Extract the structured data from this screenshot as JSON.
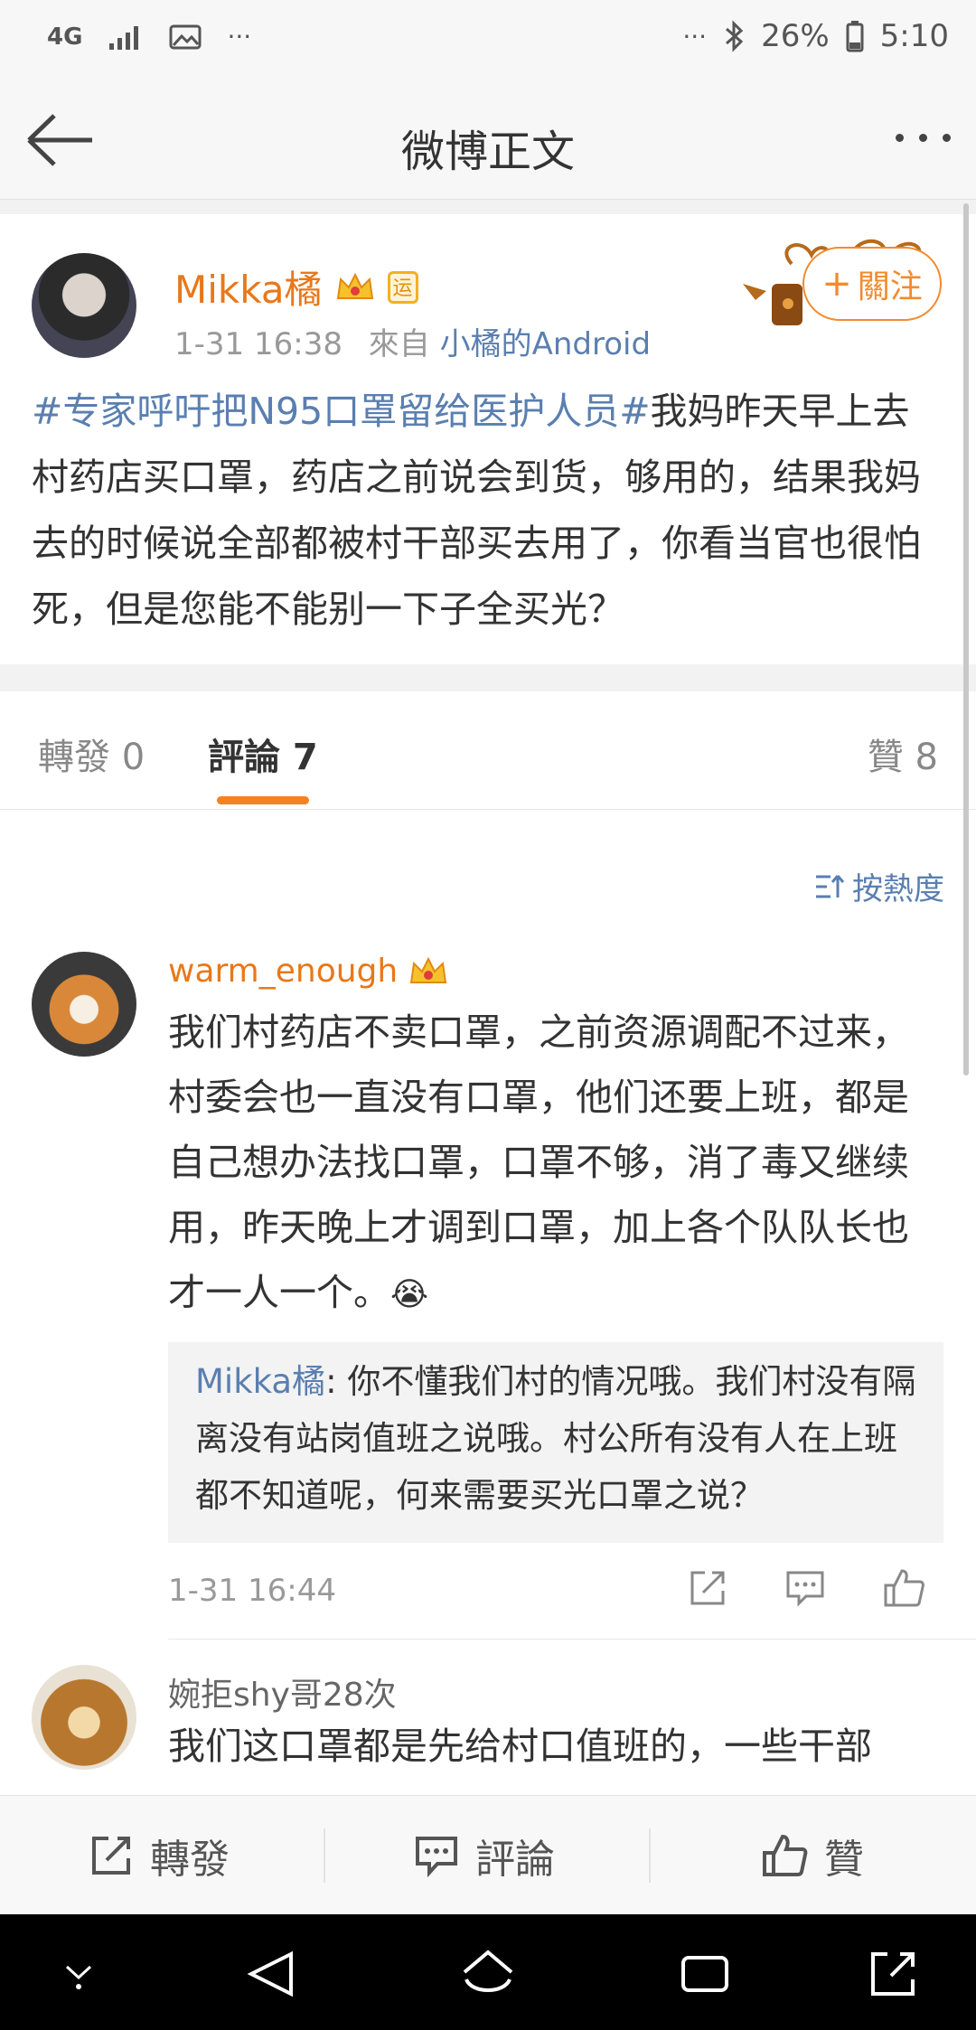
{
  "status_bar": {
    "network": "4G",
    "battery": "26%",
    "time": "5:10"
  },
  "nav": {
    "title": "微博正文"
  },
  "post": {
    "author": "Mikka橘",
    "badge_yun": "运",
    "time": "1-31 16:38",
    "source_prefix": "來自",
    "source": "小橘的Android",
    "follow_label": "關注",
    "topic": "#专家呼吁把N95口罩留给医护人员#",
    "text": "我妈昨天早上去村药店买口罩，药店之前说会到货，够用的，结果我妈去的时候说全部都被村干部买去用了，你看当官也很怕死，但是您能不能别一下子全买光？"
  },
  "tabs": {
    "repost": "轉發 0",
    "comment": "評論 7",
    "like": "贊 8"
  },
  "sort_label": "按熱度",
  "comments": [
    {
      "name": "warm_enough",
      "text": "我们村药店不卖口罩，之前资源调配不过来，村委会也一直没有口罩，他们还要上班，都是自己想办法找口罩，口罩不够，消了毒又继续用，昨天晚上才调到口罩，加上各个队队长也才一人一个。",
      "emoji": "😭",
      "reply_name": "Mikka橘",
      "reply_text": ": 你不懂我们村的情况哦。我们村没有隔离没有站岗值班之说哦。村公所有没有人在上班都不知道呢，何来需要买光口罩之说？",
      "time": "1-31 16:44"
    },
    {
      "name": "婉拒shy哥28次",
      "text": "我们这口罩都是先给村口值班的，一些干部"
    }
  ],
  "toolbar": {
    "repost": "轉發",
    "comment": "評論",
    "like": "贊"
  },
  "colors": {
    "accent": "#f5821f",
    "link": "#5a7fb0",
    "username": "#e8781a"
  }
}
